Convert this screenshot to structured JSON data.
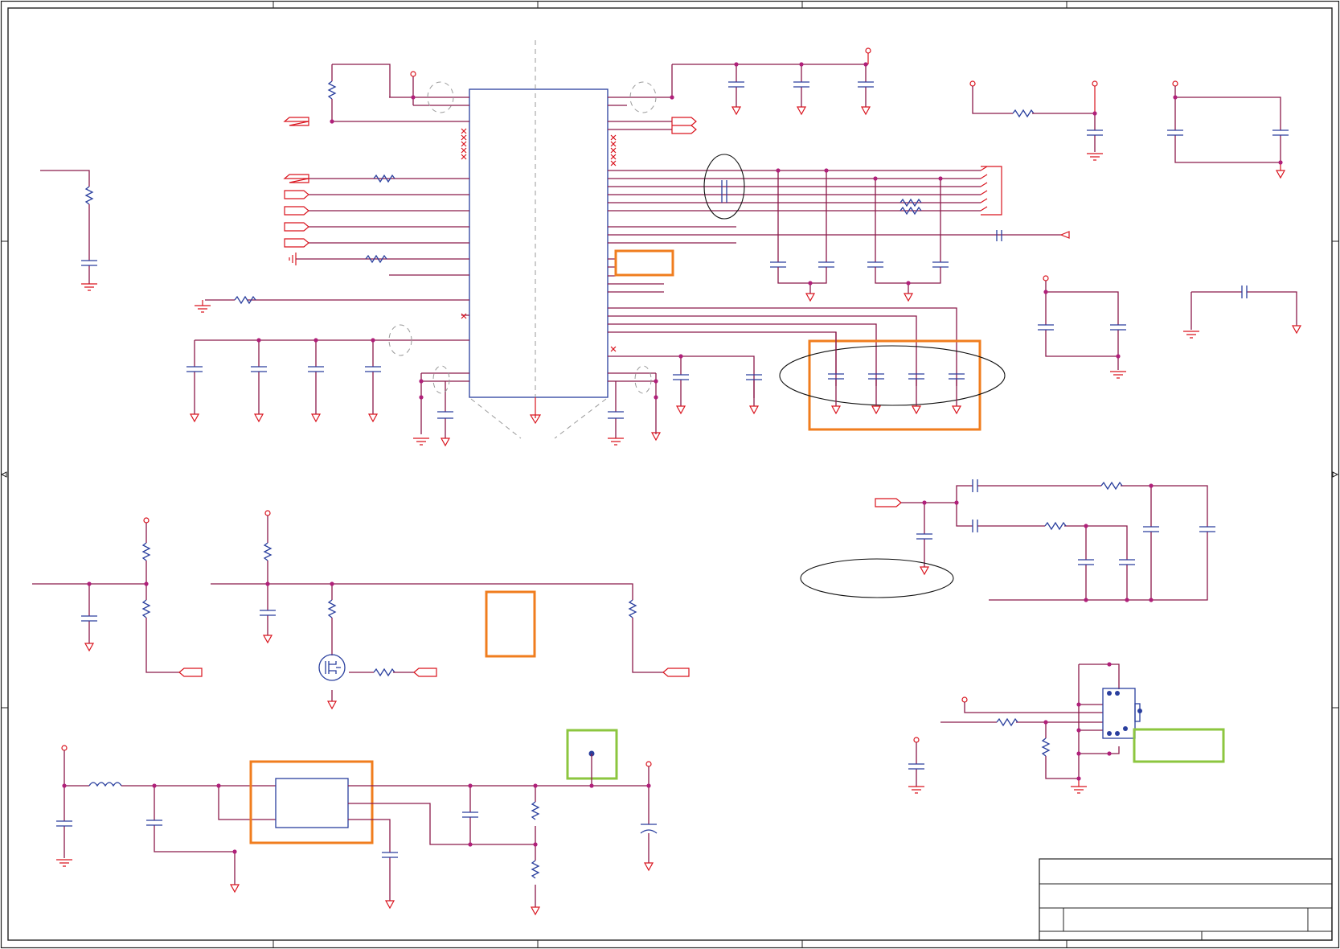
{
  "colors": {
    "wire": "#8b1a4a",
    "pin": "#d9141e",
    "component": "#2a3f9e",
    "junction": "#b0207a",
    "highlight_orange": "#f07d1e",
    "highlight_green": "#8cc63f"
  }
}
